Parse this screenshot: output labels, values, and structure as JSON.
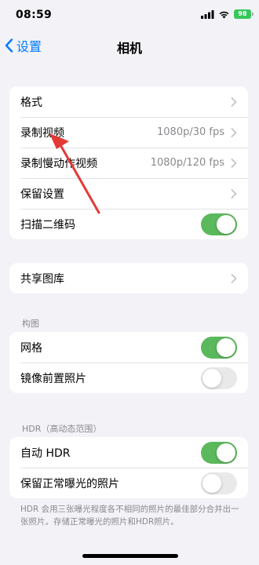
{
  "status_bar": {
    "time": "08:59",
    "battery": "98",
    "icons": [
      "cellular-signal-icon",
      "wifi-icon",
      "battery-icon"
    ]
  },
  "nav": {
    "back_label": "设置",
    "title": "相机"
  },
  "group1": [
    {
      "label": "格式",
      "value": "",
      "type": "chevron"
    },
    {
      "label": "录制视频",
      "value": "1080p/30 fps",
      "type": "chevron"
    },
    {
      "label": "录制慢动作视频",
      "value": "1080p/120 fps",
      "type": "chevron"
    },
    {
      "label": "保留设置",
      "value": "",
      "type": "chevron"
    },
    {
      "label": "扫描二维码",
      "type": "toggle",
      "on": true
    }
  ],
  "group2": [
    {
      "label": "共享图库",
      "type": "chevron"
    }
  ],
  "section_composition": {
    "header": "构图",
    "rows": [
      {
        "label": "网格",
        "type": "toggle",
        "on": true
      },
      {
        "label": "镜像前置照片",
        "type": "toggle",
        "on": false
      }
    ]
  },
  "section_hdr": {
    "header": "HDR（高动态范围）",
    "rows": [
      {
        "label": "自动 HDR",
        "type": "toggle",
        "on": true
      },
      {
        "label": "保留正常曝光的照片",
        "type": "toggle",
        "on": false
      }
    ],
    "footer": "HDR 会用三张曝光程度各不相同的照片的最佳部分合并出一张照片。存储正常曝光的照片和HDR照片。"
  },
  "colors": {
    "accent": "#007aff",
    "toggle_on": "#5cb85c",
    "annotation_arrow": "#e53935"
  }
}
